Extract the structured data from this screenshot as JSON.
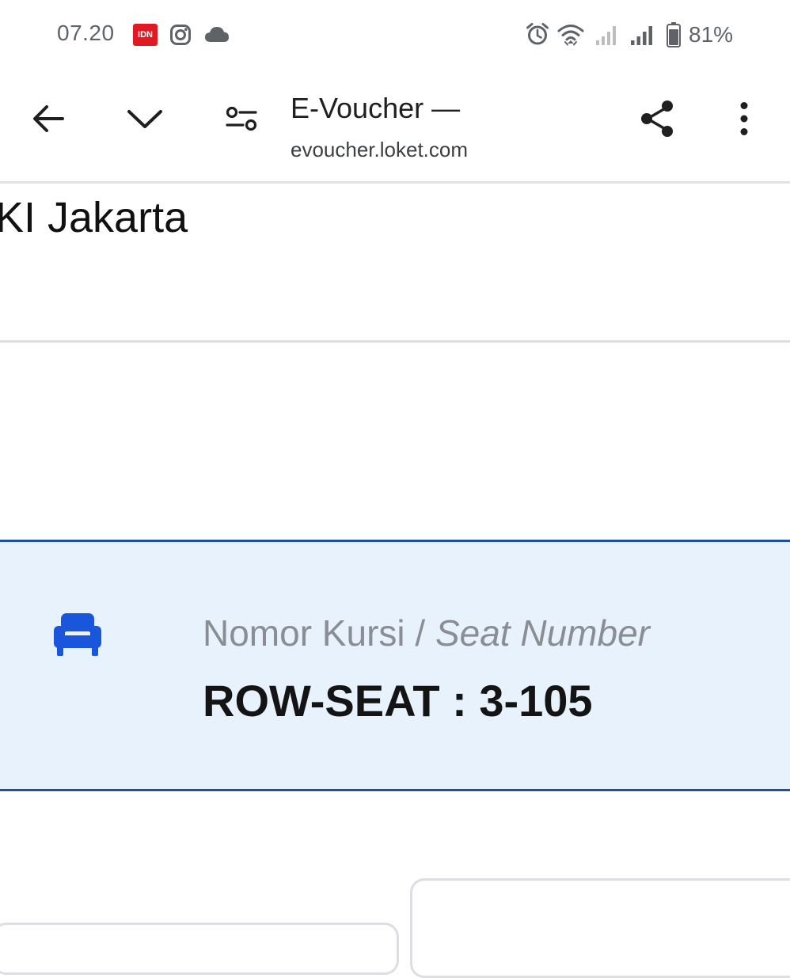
{
  "status_bar": {
    "time": "07.20",
    "notification_badge": "IDN",
    "notification_icons": [
      "idn-app-icon",
      "instagram-icon",
      "cloud-icon"
    ],
    "system_icons": [
      "alarm-icon",
      "wifi-icon",
      "signal-sim1-icon",
      "signal-sim2-icon",
      "battery-icon"
    ],
    "battery": "81%",
    "battery_level": 0.81
  },
  "browser": {
    "title": "E-Voucher —",
    "url": "evoucher.loket.com",
    "buttons": [
      "back-arrow-icon",
      "chevron-down-icon",
      "tune-icon",
      "share-icon",
      "more-vert-icon"
    ]
  },
  "page": {
    "location": "KI Jakarta",
    "seat": {
      "icon": "armchair-icon",
      "label_id": "Nomor Kursi",
      "label_separator": " / ",
      "label_en": "Seat Number",
      "value": "ROW-SEAT : 3-105"
    }
  },
  "colors": {
    "seat_panel_bg": "#e8f2fd",
    "seat_panel_border": "#1d4fa7",
    "seat_icon": "#1a56db",
    "idn_badge": "#e01a22"
  }
}
